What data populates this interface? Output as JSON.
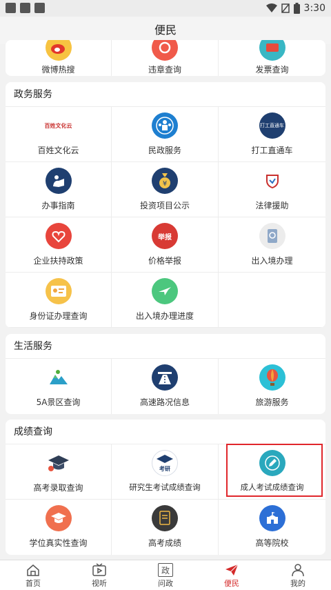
{
  "status": {
    "time": "3:30"
  },
  "header": {
    "title": "便民"
  },
  "top_row": {
    "items": [
      {
        "label": "微博热搜",
        "icon": "weibo-icon"
      },
      {
        "label": "违章查询",
        "icon": "violation-icon"
      },
      {
        "label": "发票查询",
        "icon": "invoice-icon"
      }
    ]
  },
  "gov": {
    "title": "政务服务",
    "items": [
      {
        "label": "百姓文化云",
        "icon": "culture-cloud-logo",
        "logo_text": "百姓文化云"
      },
      {
        "label": "民政服务",
        "icon": "civil-affairs-icon"
      },
      {
        "label": "打工直通车",
        "icon": "worker-bus-icon",
        "logo_text": "打工直通车"
      },
      {
        "label": "办事指南",
        "icon": "guide-icon"
      },
      {
        "label": "投资项目公示",
        "icon": "investment-icon"
      },
      {
        "label": "法律援助",
        "icon": "legal-aid-icon"
      },
      {
        "label": "企业扶持政策",
        "icon": "enterprise-support-icon"
      },
      {
        "label": "价格举报",
        "icon": "price-report-icon",
        "logo_text": "举报"
      },
      {
        "label": "出入境办理",
        "icon": "passport-icon"
      },
      {
        "label": "身份证办理查询",
        "icon": "id-card-icon"
      },
      {
        "label": "出入境办理进度",
        "icon": "airplane-icon"
      }
    ]
  },
  "life": {
    "title": "生活服务",
    "items": [
      {
        "label": "5A景区查询",
        "icon": "scenic-icon"
      },
      {
        "label": "高速路况信息",
        "icon": "highway-icon"
      },
      {
        "label": "旅游服务",
        "icon": "balloon-icon"
      }
    ]
  },
  "scores": {
    "title": "成绩查询",
    "items": [
      {
        "label": "高考录取查询",
        "icon": "graduation-cap-icon"
      },
      {
        "label": "研究生考试成绩查询",
        "icon": "postgrad-icon",
        "logo_text": "考研"
      },
      {
        "label": "成人考试成绩查询",
        "icon": "pencil-icon"
      },
      {
        "label": "学位真实性查询",
        "icon": "degree-cap-icon"
      },
      {
        "label": "高考成绩",
        "icon": "score-report-icon"
      },
      {
        "label": "高等院校",
        "icon": "university-icon"
      }
    ]
  },
  "tabs": [
    {
      "label": "首页",
      "icon": "home-icon"
    },
    {
      "label": "视听",
      "icon": "tv-icon"
    },
    {
      "label": "问政",
      "icon": "politics-icon",
      "glyph": "政"
    },
    {
      "label": "便民",
      "icon": "send-icon"
    },
    {
      "label": "我的",
      "icon": "user-icon"
    }
  ],
  "colors": {
    "accent": "#d42a2a",
    "highlight": "#e0262b",
    "navy": "#1f3f70",
    "teal": "#2c9ad6"
  }
}
